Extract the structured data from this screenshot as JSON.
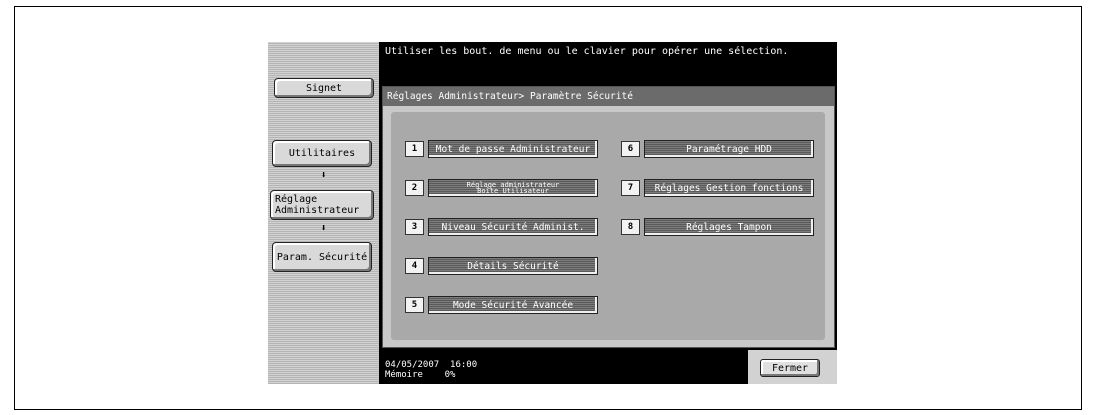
{
  "header": {
    "message": "Utiliser les bout. de menu ou le clavier pour opérer une sélection."
  },
  "sidebar": {
    "bookmark_label": "Signet",
    "utilities_label": "Utilitaires",
    "admin_setting_label": "Réglage Administrateur",
    "security_param_label": "Param. Sécurité",
    "arrow_glyph": "⬇"
  },
  "panel": {
    "title": "Réglages Administrateur> Paramètre Sécurité",
    "items": [
      {
        "num": "1",
        "label": "Mot de passe Administrateur"
      },
      {
        "num": "2",
        "label_line1": "Réglage administrateur",
        "label_line2": "Boîte Utilisateur"
      },
      {
        "num": "3",
        "label": "Niveau Sécurité Administ."
      },
      {
        "num": "4",
        "label": "Détails Sécurité"
      },
      {
        "num": "5",
        "label": "Mode Sécurité Avancée"
      },
      {
        "num": "6",
        "label": "Paramétrage HDD"
      },
      {
        "num": "7",
        "label": "Réglages Gestion fonctions"
      },
      {
        "num": "8",
        "label": "Réglages Tampon"
      }
    ]
  },
  "footer": {
    "date": "04/05/2007",
    "time": "16:00",
    "memory_label": "Mémoire",
    "memory_value": "0%"
  },
  "close_label": "Fermer"
}
